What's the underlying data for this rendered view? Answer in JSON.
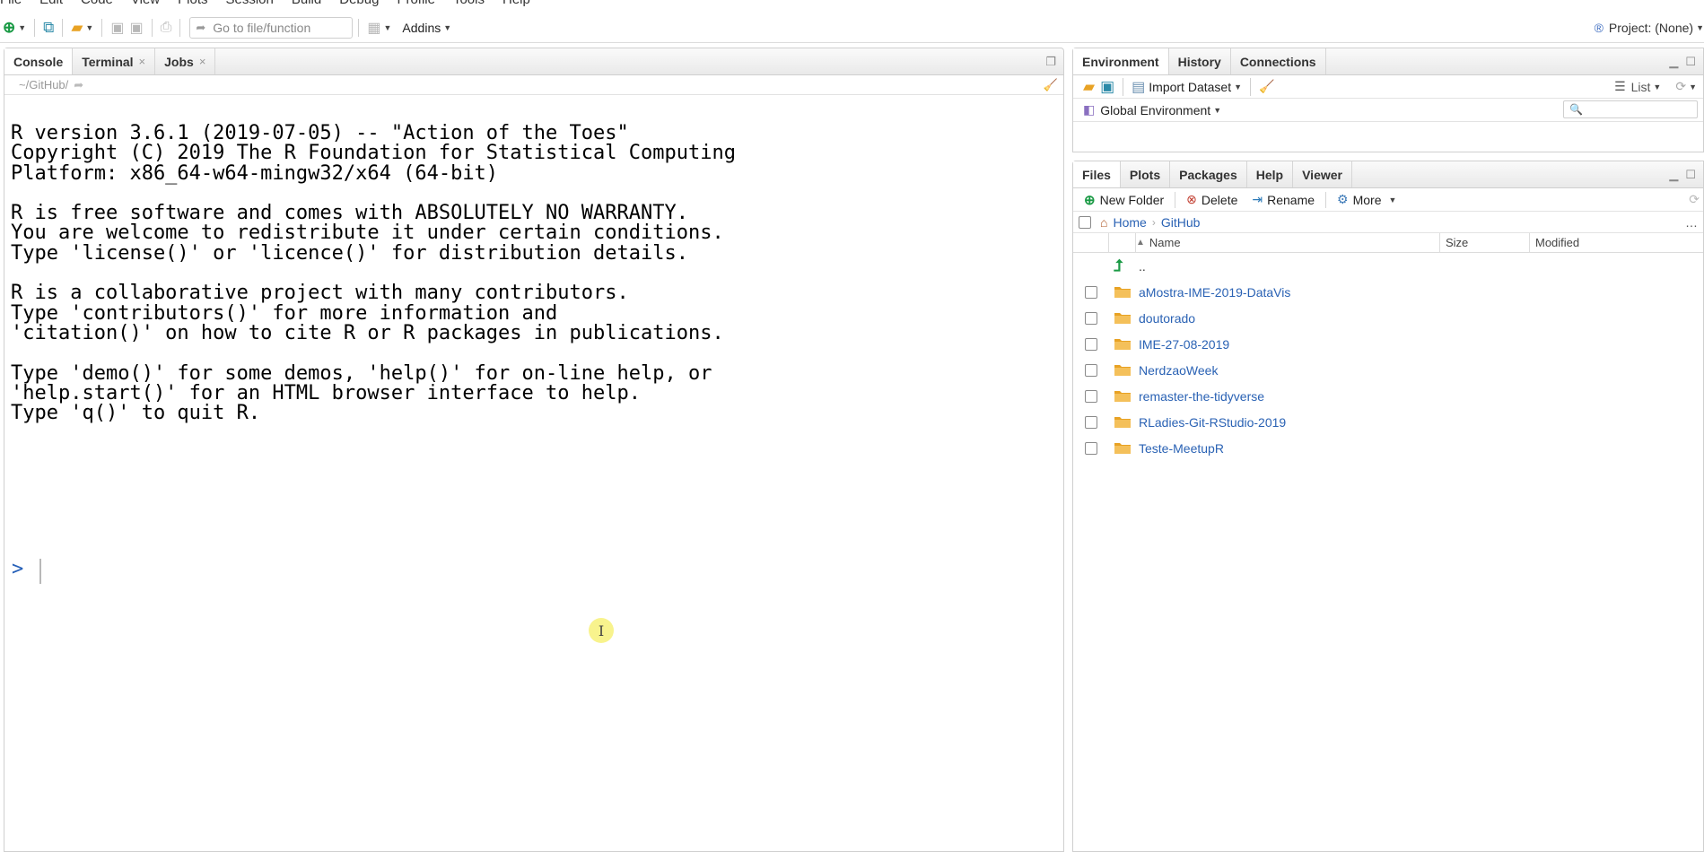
{
  "menu": [
    "File",
    "Edit",
    "Code",
    "View",
    "Plots",
    "Session",
    "Build",
    "Debug",
    "Profile",
    "Tools",
    "Help"
  ],
  "toolbar": {
    "goto_placeholder": "Go to file/function",
    "addins_label": "Addins",
    "project_label": "Project: (None)"
  },
  "console_pane": {
    "tabs": [
      {
        "label": "Console",
        "active": true,
        "closable": false
      },
      {
        "label": "Terminal",
        "active": false,
        "closable": true
      },
      {
        "label": "Jobs",
        "active": false,
        "closable": true
      }
    ],
    "path": "~/GitHub/",
    "output_lines": [
      "R version 3.6.1 (2019-07-05) -- \"Action of the Toes\"",
      "Copyright (C) 2019 The R Foundation for Statistical Computing",
      "Platform: x86_64-w64-mingw32/x64 (64-bit)",
      "",
      "R is free software and comes with ABSOLUTELY NO WARRANTY.",
      "You are welcome to redistribute it under certain conditions.",
      "Type 'license()' or 'licence()' for distribution details.",
      "",
      "R is a collaborative project with many contributors.",
      "Type 'contributors()' for more information and",
      "'citation()' on how to cite R or R packages in publications.",
      "",
      "Type 'demo()' for some demos, 'help()' for on-line help, or",
      "'help.start()' for an HTML browser interface to help.",
      "Type 'q()' to quit R."
    ],
    "prompt": ">"
  },
  "env_pane": {
    "tabs": [
      {
        "label": "Environment",
        "active": true
      },
      {
        "label": "History",
        "active": false
      },
      {
        "label": "Connections",
        "active": false
      }
    ],
    "import_dataset_label": "Import Dataset",
    "list_label": "List",
    "scope_label": "Global Environment"
  },
  "files_pane": {
    "tabs": [
      {
        "label": "Files",
        "active": true
      },
      {
        "label": "Plots",
        "active": false
      },
      {
        "label": "Packages",
        "active": false
      },
      {
        "label": "Help",
        "active": false
      },
      {
        "label": "Viewer",
        "active": false
      }
    ],
    "toolbar": {
      "new_folder": "New Folder",
      "delete": "Delete",
      "rename": "Rename",
      "more": "More"
    },
    "breadcrumb": [
      "Home",
      "GitHub"
    ],
    "columns": {
      "name": "Name",
      "size": "Size",
      "modified": "Modified"
    },
    "parent_dir": "..",
    "files": [
      "aMostra-IME-2019-DataVis",
      "doutorado",
      "IME-27-08-2019",
      "NerdzaoWeek",
      "remaster-the-tidyverse",
      "RLadies-Git-RStudio-2019",
      "Teste-MeetupR"
    ]
  },
  "colors": {
    "link_blue": "#2a62b4",
    "prompt_blue": "#2660b8",
    "folder_orange": "#e8a224",
    "icon_green": "#1a9a45"
  }
}
